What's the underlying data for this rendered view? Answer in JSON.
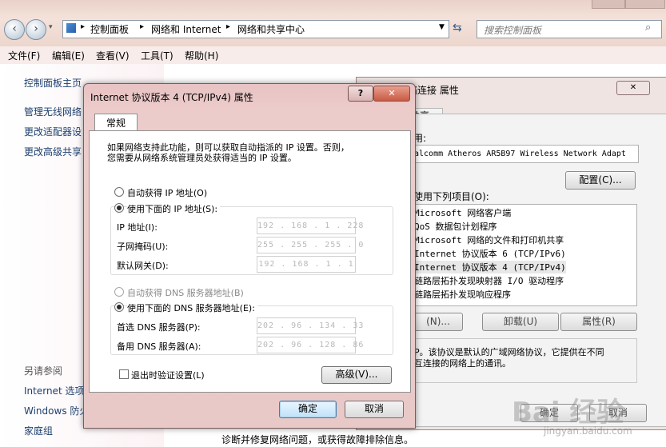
{
  "explorer": {
    "breadcrumb": [
      "控制面板",
      "网络和 Internet",
      "网络和共享中心"
    ],
    "search_placeholder": "搜索控制面板",
    "menu": [
      "文件(F)",
      "编辑(E)",
      "查看(V)",
      "工具(T)",
      "帮助(H)"
    ],
    "left_links": [
      "控制面板主页",
      "管理无线网络",
      "更改适配器设",
      "更改高级共享"
    ],
    "see_also_header": "另请参阅",
    "see_also": [
      "Internet 选项",
      "Windows 防火",
      "家庭组"
    ],
    "bottom_text": "诊断并修复网络问题，或获得故障排除信息。"
  },
  "adapter_dialog": {
    "title_partial": "络连接 属性",
    "tab_partial": "共享",
    "connect_using_partial": "用:",
    "adapter_name": "alcomm Atheros AR5B97 Wireless Network Adapt",
    "configure_button": "配置(C)...",
    "items_label_partial": "使用下列项目(O):",
    "items": [
      "Microsoft 网络客户端",
      "QoS 数据包计划程序",
      "Microsoft 网络的文件和打印机共享",
      "Internet 协议版本 6 (TCP/IPv6)",
      "Internet 协议版本 4 (TCP/IPv4)",
      "链路层拓扑发现映射器 I/O 驱动程序",
      "链路层拓扑发现响应程序"
    ],
    "install_button_partial": "(N)...",
    "uninstall_button": "卸载(U)",
    "properties_button": "属性(R)",
    "description_line1": "P。该协议是默认的广域网络协议，它提供在不同",
    "description_line2": "互连接的网络上的通讯。",
    "ok_partial": "确定",
    "cancel_partial": "取消"
  },
  "ipv4_dialog": {
    "title": "Internet 协议版本 4 (TCP/IPv4) 属性",
    "help_button": "?",
    "close_button": "✕",
    "tab": "常规",
    "intro_line1": "如果网络支持此功能，则可以获取自动指派的 IP 设置。否则，",
    "intro_line2": "您需要从网络系统管理员处获得适当的 IP 设置。",
    "auto_ip": "自动获得 IP 地址(O)",
    "manual_ip": "使用下面的 IP 地址(S):",
    "ip_label": "IP 地址(I):",
    "subnet_label": "子网掩码(U):",
    "gateway_label": "默认网关(D):",
    "ip_value": "192 . 168 . 1 . 228",
    "subnet_value": "255 . 255 . 255 . 0",
    "gateway_value": "192 . 168 . 1 . 1",
    "auto_dns": "自动获得 DNS 服务器地址(B)",
    "manual_dns": "使用下面的 DNS 服务器地址(E):",
    "preferred_dns_label": "首选 DNS 服务器(P):",
    "alternate_dns_label": "备用 DNS 服务器(A):",
    "preferred_dns_value": "202 . 96 . 134 . 33",
    "alternate_dns_value": "202 . 96 . 128 . 86",
    "validate_label": "退出时验证设置(L)",
    "advanced_button": "高级(V)...",
    "ok_button": "确定",
    "cancel_button": "取消"
  },
  "watermark": {
    "text": "Bai 经验",
    "sub": "jingyan.baidu.com"
  }
}
